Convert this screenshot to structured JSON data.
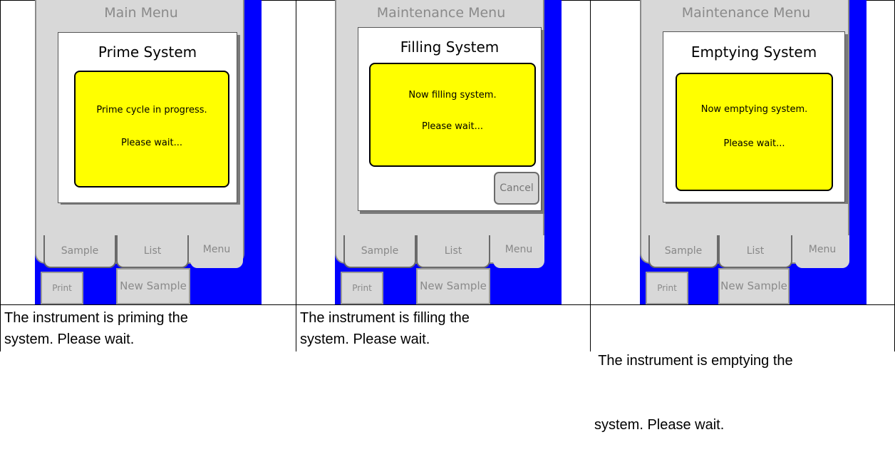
{
  "panels": [
    {
      "menu_title": "Main Menu",
      "dialog_title": "Prime System",
      "message_lines": [
        "Prime cycle in progress.",
        "Please wait..."
      ],
      "cancel_label": "",
      "tabs": [
        "Sample",
        "List",
        "Menu"
      ],
      "buttons": [
        "Print",
        "New Sample"
      ],
      "caption": [
        "The instrument is priming the",
        "system. Please wait."
      ]
    },
    {
      "menu_title": "Maintenance Menu",
      "dialog_title": "Filling System",
      "message_lines": [
        "Now filling system.",
        "Please wait..."
      ],
      "cancel_label": "Cancel",
      "tabs": [
        "Sample",
        "List",
        "Menu"
      ],
      "buttons": [
        "Print",
        "New Sample"
      ],
      "caption": [
        "The instrument is filling the",
        "system. Please wait."
      ]
    },
    {
      "menu_title": "Maintenance Menu",
      "dialog_title": "Emptying System",
      "message_lines": [
        "Now emptying system.",
        "Please wait..."
      ],
      "cancel_label": "",
      "tabs": [
        "Sample",
        "List",
        "Menu"
      ],
      "buttons": [
        "Print",
        "New Sample"
      ],
      "caption": [
        " The instrument is emptying the",
        "system. Please wait."
      ]
    }
  ],
  "colors": {
    "screen_background": "#0000ff",
    "message_box": "#ffff00",
    "device_gray": "#d8d8d8"
  }
}
